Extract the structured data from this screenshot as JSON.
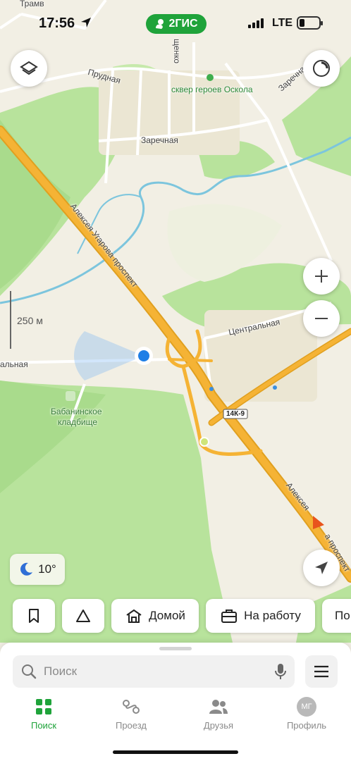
{
  "status_bar": {
    "time": "17:56",
    "network": "LTE",
    "brand": "2ГИС"
  },
  "map": {
    "labels": {
      "park": "сквер героев Оскола",
      "prudnaya": "Прудная",
      "zarechnaya": "Заречная",
      "zarechnaya2": "Заречная",
      "shchenko": "щенко",
      "tramv": "Трамв",
      "prospekt": "Алексея Угарова проспект",
      "tsentralnaya": "Центральная",
      "alnaya": "альная",
      "cemetery_line1": "Бабанинское",
      "cemetery_line2": "кладбище",
      "road_number": "14К-9",
      "alekseya": "Алексея",
      "prospekt_end": "а проспект"
    },
    "scale": "250 м",
    "weather_temp": "10°"
  },
  "quick_chips": {
    "home": "Домой",
    "work": "На работу",
    "more": "По"
  },
  "search": {
    "placeholder": "Поиск"
  },
  "tabs": [
    {
      "label": "Поиск"
    },
    {
      "label": "Проезд"
    },
    {
      "label": "Друзья"
    },
    {
      "label": "Профиль",
      "avatar": "МГ"
    }
  ],
  "colors": {
    "accent": "#1fa33a",
    "road": "#f5b335",
    "water": "#7cc5dd",
    "forest": "#b8e39c"
  }
}
